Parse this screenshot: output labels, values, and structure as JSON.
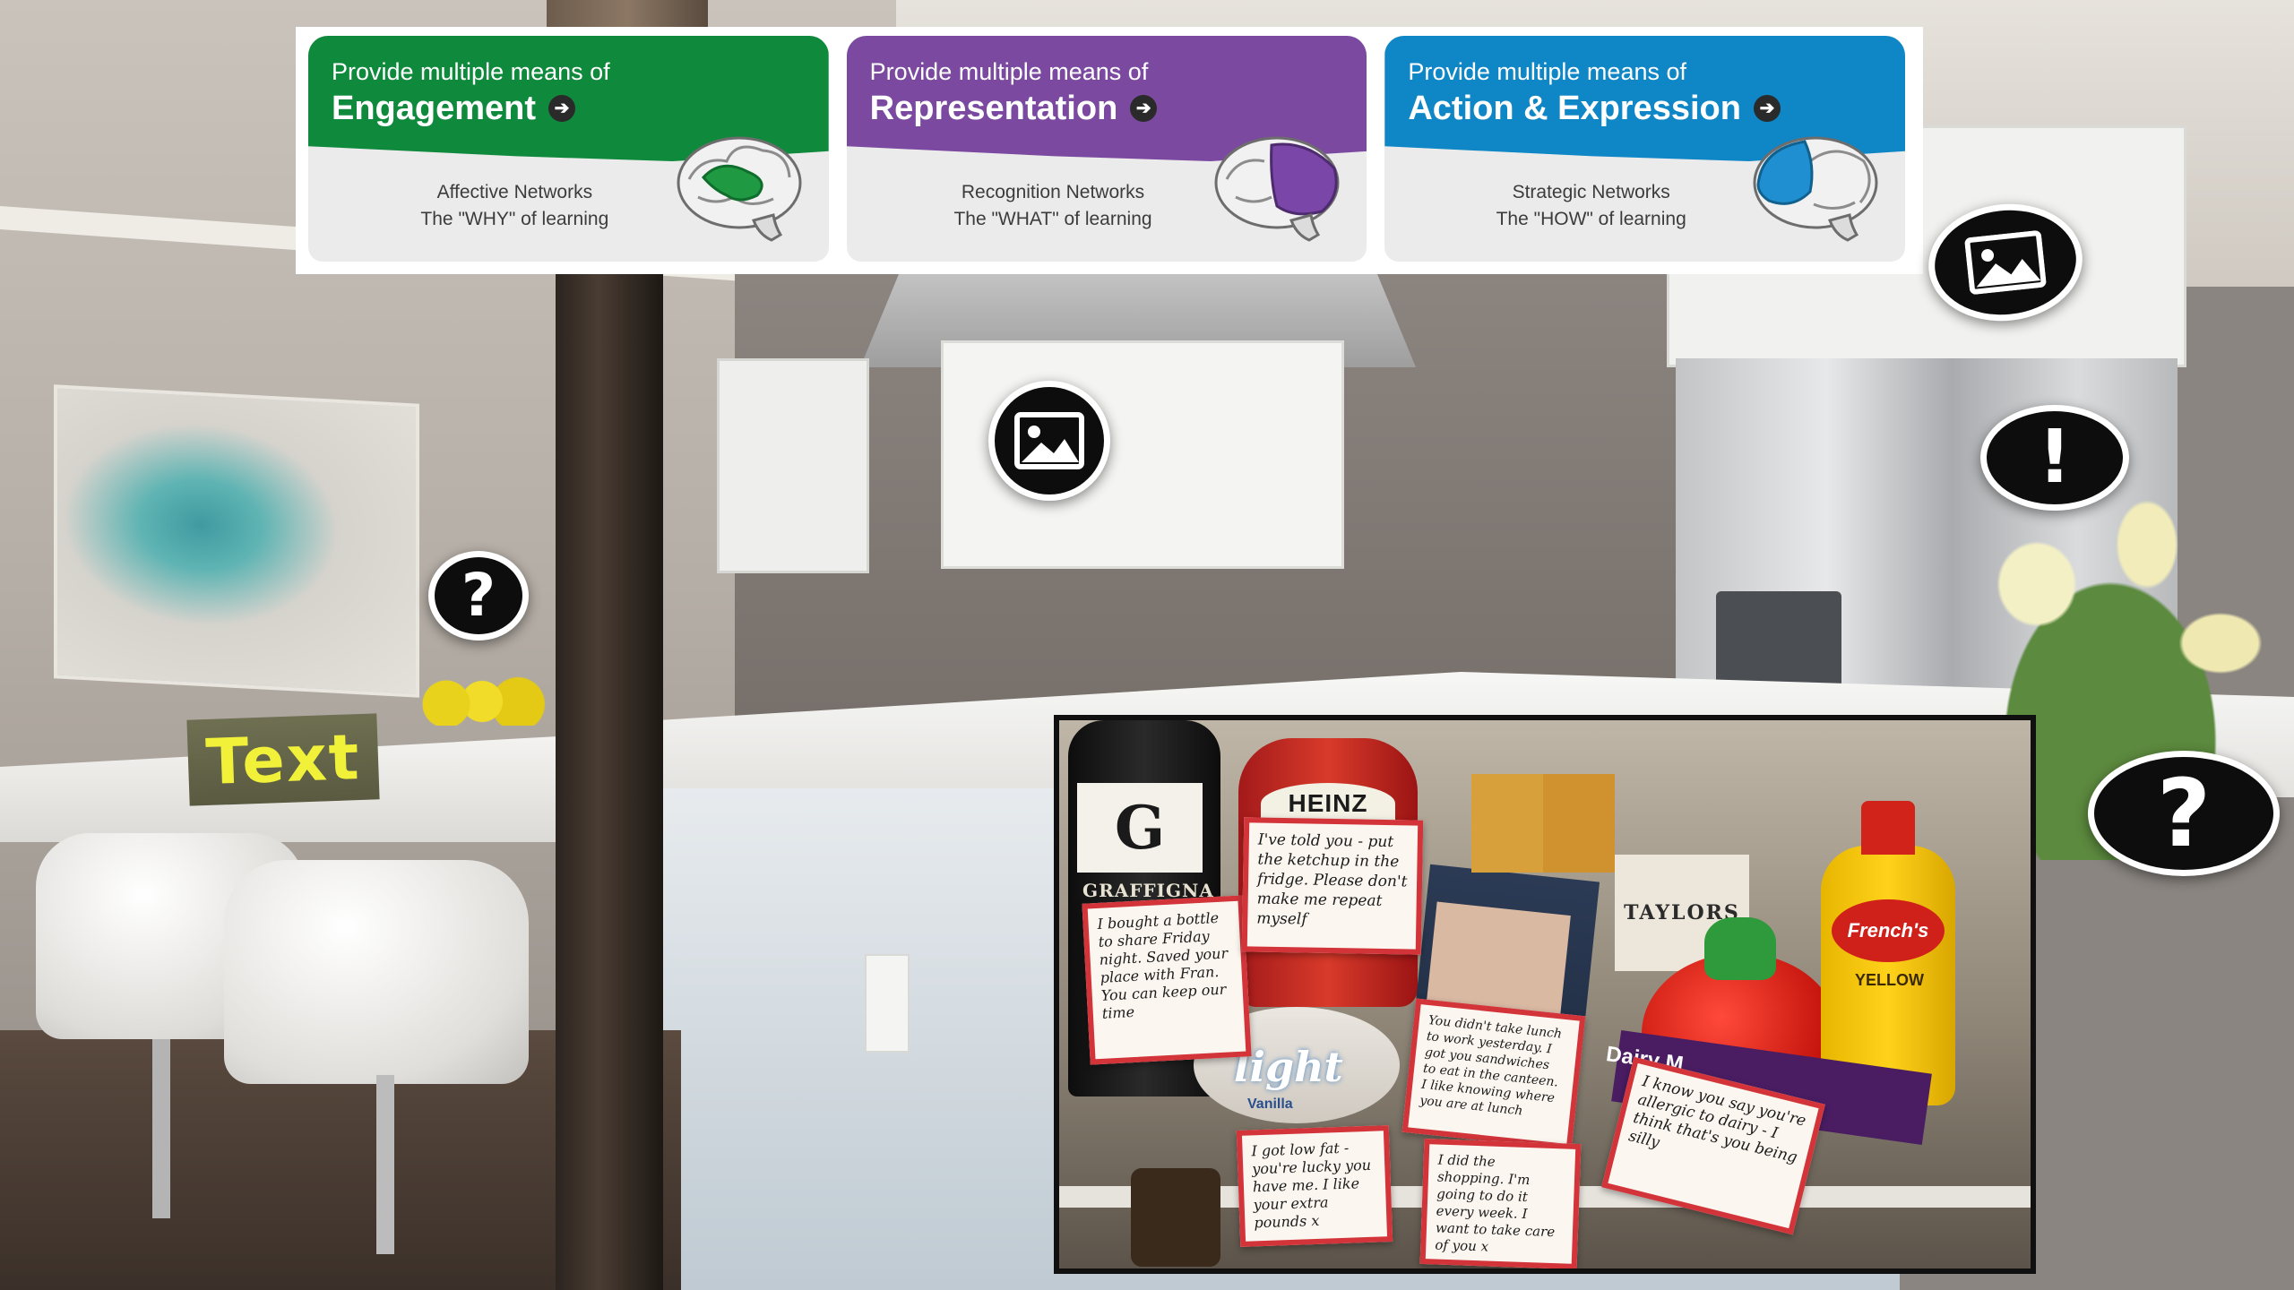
{
  "colors": {
    "engagement": "#0f8a3c",
    "representation": "#7b4aa0",
    "action_expression": "#0f86c6",
    "hotspot": "#0d0d0d",
    "text_tag": "#f1f13a"
  },
  "udl_cards": [
    {
      "intro": "Provide multiple means of",
      "title": "Engagement",
      "network": "Affective Networks",
      "tagline": "The \"WHY\" of learning",
      "icon": "brain-engagement-icon"
    },
    {
      "intro": "Provide multiple means of",
      "title": "Representation",
      "network": "Recognition Networks",
      "tagline": "The \"WHAT\" of learning",
      "icon": "brain-representation-icon"
    },
    {
      "intro": "Provide multiple means of",
      "title": "Action & Expression",
      "network": "Strategic Networks",
      "tagline": "The \"HOW\" of learning",
      "icon": "brain-action-icon"
    }
  ],
  "hotspots": {
    "question_left": {
      "glyph": "?",
      "icon": "question-icon"
    },
    "image_center": {
      "icon": "image-icon"
    },
    "image_right": {
      "icon": "image-icon"
    },
    "exclamation_right": {
      "glyph": "!",
      "icon": "exclamation-icon"
    },
    "question_right": {
      "glyph": "?",
      "icon": "question-icon"
    }
  },
  "text_tag": {
    "label": "Text"
  },
  "fridge_photo": {
    "brands": {
      "wine": "G",
      "wine_name": "GRAFFIGNA",
      "ketchup": "HEINZ",
      "tea": "TAYLORS",
      "mustard": "French's",
      "mustard_sub": "YELLOW",
      "yogurt": "light",
      "yogurt_flavor": "Vanilla",
      "chocolate": "Dairy M"
    },
    "notes": {
      "wine": "I bought a bottle to share Friday night. Saved your place with Fran. You can keep our time",
      "ketchup": "I've told you - put the ketchup in the fridge. Please don't make me repeat myself",
      "sandwich": "You didn't take lunch to work yesterday. I got you sandwiches to eat in the canteen. I like knowing where you are at lunch",
      "yogurt": "I got low fat - you're lucky you have me. I like your extra pounds x",
      "shopping": "I did the shopping. I'm going to do it every week. I want to take care of you x",
      "dairy": "I know you say you're allergic to dairy - I think that's you being silly"
    }
  }
}
